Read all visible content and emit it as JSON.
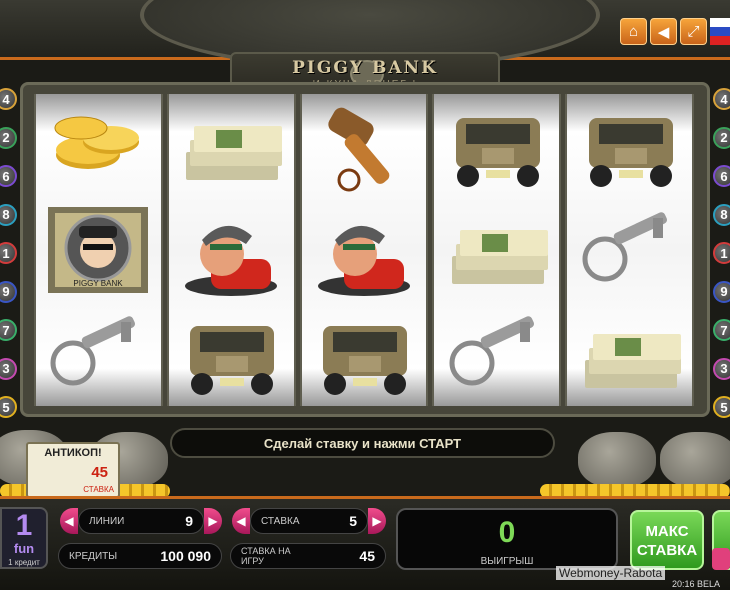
{
  "header": {
    "icons": [
      "home-icon",
      "sound-icon",
      "fullscreen-icon"
    ],
    "language_flag": "ru"
  },
  "logo": {
    "title": "PIGGY BANK",
    "subtitle": "И КУЧА ДЕНЕГ !"
  },
  "paylines": {
    "left": [
      "4",
      "2",
      "6",
      "8",
      "1",
      "9",
      "7",
      "3",
      "5"
    ],
    "right": [
      "4",
      "2",
      "6",
      "8",
      "1",
      "9",
      "7",
      "3",
      "5"
    ]
  },
  "reels": [
    [
      "gold-coins",
      "piggy-bank-robber-scatter",
      "key"
    ],
    [
      "cash-stack",
      "robber",
      "truck"
    ],
    [
      "hammer",
      "robber",
      "truck"
    ],
    [
      "truck",
      "cash-stack",
      "key"
    ],
    [
      "truck",
      "key",
      "cash-stack"
    ]
  ],
  "status_message": "Сделай ставку и нажми СТАРТ",
  "anticop": {
    "title": "АНТИКОП!",
    "value": "45",
    "label": "СТАВКА"
  },
  "fun": {
    "value": "1",
    "label": "fun",
    "sub": "1 кредит"
  },
  "panel": {
    "lines": {
      "label": "ЛИНИИ",
      "value": "9"
    },
    "credits": {
      "label": "КРЕДИТЫ",
      "value": "100 090"
    },
    "bet": {
      "label": "СТАВКА",
      "value": "5"
    },
    "total_bet": {
      "label": "СТАВКА НА ИГРУ",
      "value": "45"
    },
    "win": {
      "value": "0",
      "label": "ВЫИГРЫШ"
    },
    "max_bet_label": "МАКС СТАВКА"
  },
  "watermark": "Webmoney-Rabota",
  "clock": "20:16 BELA"
}
